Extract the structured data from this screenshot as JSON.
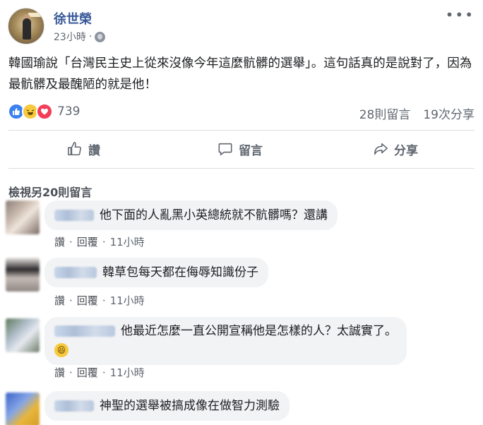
{
  "post": {
    "author": "徐世榮",
    "time": "23小時",
    "text": "韓國瑜說「台灣民主史上從來沒像今年這麼骯髒的選舉」。這句話真的是說對了，因為最骯髒及最醜陋的就是他！",
    "reaction_count": "739",
    "comment_count": "28則留言",
    "share_count": "19次分享",
    "reactions": [
      "like-icon",
      "haha-icon",
      "love-icon"
    ]
  },
  "actions": {
    "like": "讚",
    "comment": "留言",
    "share": "分享"
  },
  "comments_section": {
    "view_more": "檢視另20則留言",
    "comments": [
      {
        "text": "他下面的人亂黑小英總統就不骯髒嗎？還講",
        "like": "讚",
        "reply": "回覆",
        "time": "11小時"
      },
      {
        "text": "韓草包每天都在侮辱知識份子",
        "like": "讚",
        "reply": "回覆",
        "time": "11小時"
      },
      {
        "text": "他最近怎麼一直公開宣稱他是怎樣的人？太誠實了。",
        "like": "讚",
        "reply": "回覆",
        "time": "11小時"
      },
      {
        "text": "神聖的選舉被搞成像在做智力測驗"
      }
    ]
  },
  "colors": {
    "link_blue": "#385898",
    "like_blue": "#3b80f0",
    "love_red": "#f33e58",
    "haha_yellow": "#f7c93e",
    "bubble_gray": "#f2f3f5"
  }
}
